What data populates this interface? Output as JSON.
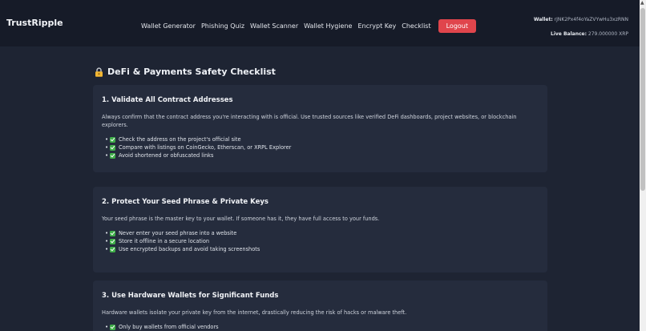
{
  "brand": "TrustRipple",
  "nav": {
    "items": [
      "Wallet Generator",
      "Phishing Quiz",
      "Wallet Scanner",
      "Wallet Hygiene",
      "Encrypt Key",
      "Checklist"
    ],
    "logout_label": "Logout"
  },
  "wallet": {
    "address_label": "Wallet:",
    "address": "rJNK2Px4f4oYaZVYwHu3xzRNN",
    "balance_label": "Live Balance:",
    "balance": "279.000000 XRP"
  },
  "page": {
    "title": "DeFi & Payments Safety Checklist",
    "title_icon": "lock-icon"
  },
  "sections": [
    {
      "title": "1. Validate All Contract Addresses",
      "description": "Always confirm that the contract address you're interacting with is official. Use trusted sources like verified DeFi dashboards, project websites, or blockchain explorers.",
      "items": [
        "Check the address on the project's official site",
        "Compare with listings on CoinGecko, Etherscan, or XRPL Explorer",
        "Avoid shortened or obfuscated links"
      ]
    },
    {
      "title": "2. Protect Your Seed Phrase & Private Keys",
      "description": "Your seed phrase is the master key to your wallet. If someone has it, they have full access to your funds.",
      "items": [
        "Never enter your seed phrase into a website",
        "Store it offline in a secure location",
        "Use encrypted backups and avoid taking screenshots"
      ]
    },
    {
      "title": "3. Use Hardware Wallets for Significant Funds",
      "description": "Hardware wallets isolate your private key from the internet, drastically reducing the risk of hacks or malware theft.",
      "items": [
        "Only buy wallets from official vendors"
      ]
    }
  ],
  "colors": {
    "background": "#1e2433",
    "topbar": "#161b28",
    "card": "#252c3d",
    "logout": "#e0454c",
    "check": "#3fae49"
  }
}
